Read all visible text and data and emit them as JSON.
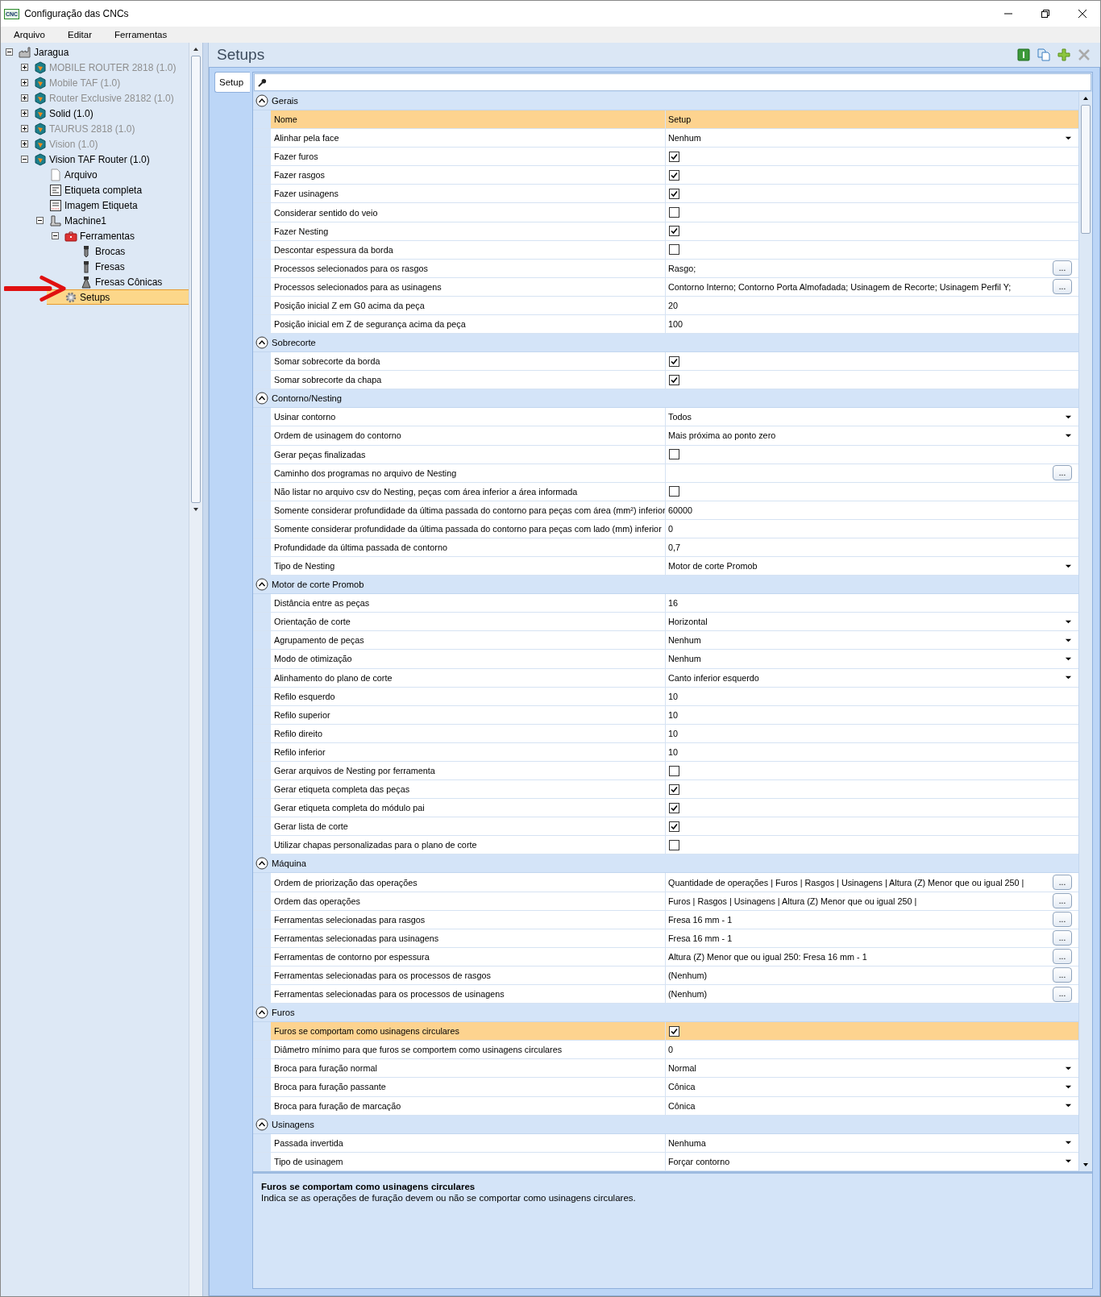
{
  "window": {
    "icon_label": "CNC",
    "title": "Configuração das CNCs"
  },
  "menu": [
    "Arquivo",
    "Editar",
    "Ferramentas"
  ],
  "tree": [
    {
      "label": "Jaragua",
      "kind": "factory",
      "expanded": true,
      "disabled": false,
      "selected": false,
      "children": [
        {
          "label": "MOBILE ROUTER 2818 (1.0)",
          "kind": "machine",
          "expanded": false,
          "disabled": true,
          "selected": false
        },
        {
          "label": "Mobile TAF (1.0)",
          "kind": "machine",
          "expanded": false,
          "disabled": true,
          "selected": false
        },
        {
          "label": "Router Exclusive 28182 (1.0)",
          "kind": "machine",
          "expanded": false,
          "disabled": true,
          "selected": false
        },
        {
          "label": "Solid (1.0)",
          "kind": "machine",
          "expanded": false,
          "disabled": false,
          "selected": false
        },
        {
          "label": "TAURUS 2818 (1.0)",
          "kind": "machine",
          "expanded": false,
          "disabled": true,
          "selected": false
        },
        {
          "label": "Vision (1.0)",
          "kind": "machine",
          "expanded": false,
          "disabled": true,
          "selected": false
        },
        {
          "label": "Vision TAF Router (1.0)",
          "kind": "machine",
          "expanded": true,
          "disabled": false,
          "selected": false,
          "children": [
            {
              "label": "Arquivo",
              "kind": "file",
              "disabled": false,
              "selected": false
            },
            {
              "label": "Etiqueta completa",
              "kind": "label",
              "disabled": false,
              "selected": false
            },
            {
              "label": "Imagem Etiqueta",
              "kind": "image-label",
              "disabled": false,
              "selected": false
            },
            {
              "label": "Machine1",
              "kind": "machine-tool",
              "expanded": true,
              "disabled": false,
              "selected": false,
              "children": [
                {
                  "label": "Ferramentas",
                  "kind": "toolbox",
                  "expanded": true,
                  "disabled": false,
                  "selected": false,
                  "children": [
                    {
                      "label": "Brocas",
                      "kind": "drill",
                      "disabled": false,
                      "selected": false
                    },
                    {
                      "label": "Fresas",
                      "kind": "mill",
                      "disabled": false,
                      "selected": false
                    },
                    {
                      "label": "Fresas Cônicas",
                      "kind": "cone-mill",
                      "disabled": false,
                      "selected": false
                    }
                  ]
                },
                {
                  "label": "Setups",
                  "kind": "gear",
                  "disabled": false,
                  "selected": true
                }
              ]
            }
          ]
        }
      ]
    }
  ],
  "panel": {
    "title": "Setups"
  },
  "tabs": [
    {
      "label": "Setup",
      "selected": true
    }
  ],
  "grid": {
    "columns": [
      "Nome",
      "Setup"
    ],
    "categories": [
      {
        "name": "Gerais",
        "expanded": true,
        "rows": [
          {
            "name": "Alinhar pela face",
            "kind": "dropdown",
            "value": "Nenhum",
            "selected": false
          },
          {
            "name": "Fazer furos",
            "kind": "checkbox",
            "checked": true,
            "selected": false
          },
          {
            "name": "Fazer rasgos",
            "kind": "checkbox",
            "checked": true,
            "selected": false
          },
          {
            "name": "Fazer usinagens",
            "kind": "checkbox",
            "checked": true,
            "selected": false
          },
          {
            "name": "Considerar sentido do veio",
            "kind": "checkbox",
            "checked": false,
            "selected": false
          },
          {
            "name": "Fazer Nesting",
            "kind": "checkbox",
            "checked": true,
            "selected": false
          },
          {
            "name": "Descontar espessura da borda",
            "kind": "checkbox",
            "checked": false,
            "selected": false
          },
          {
            "name": "Processos selecionados para os rasgos",
            "kind": "list",
            "value": "Rasgo;",
            "button": "...",
            "selected": false
          },
          {
            "name": "Processos selecionados para as usinagens",
            "kind": "list",
            "value": "Contorno Interno; Contorno Porta Almofadada; Usinagem de Recorte; Usinagem Perfil Y;",
            "button": "...",
            "selected": false
          },
          {
            "name": "Posição inicial Z em G0 acima da peça",
            "kind": "text",
            "value": "20",
            "selected": false
          },
          {
            "name": "Posição inicial em Z de segurança acima da peça",
            "kind": "text",
            "value": "100",
            "selected": false
          }
        ]
      },
      {
        "name": "Sobrecorte",
        "expanded": true,
        "rows": [
          {
            "name": "Somar sobrecorte da borda",
            "kind": "checkbox",
            "checked": true,
            "selected": false
          },
          {
            "name": "Somar sobrecorte da chapa",
            "kind": "checkbox",
            "checked": true,
            "selected": false
          }
        ]
      },
      {
        "name": "Contorno/Nesting",
        "expanded": true,
        "rows": [
          {
            "name": "Usinar contorno",
            "kind": "dropdown",
            "value": "Todos",
            "selected": false
          },
          {
            "name": "Ordem de usinagem do contorno",
            "kind": "dropdown",
            "value": "Mais próxima ao ponto zero",
            "selected": false
          },
          {
            "name": "Gerar peças finalizadas",
            "kind": "checkbox",
            "checked": false,
            "selected": false
          },
          {
            "name": "Caminho dos programas no arquivo de Nesting",
            "kind": "list",
            "button": "...",
            "selected": false
          },
          {
            "name": "Não listar no arquivo csv do Nesting, peças com área inferior a área informada",
            "kind": "checkbox",
            "checked": false,
            "selected": false
          },
          {
            "name": "Somente considerar profundidade da última passada do contorno para peças com área (mm²) inferior",
            "kind": "text",
            "value": "60000",
            "selected": false
          },
          {
            "name": "Somente considerar profundidade da última passada do contorno para peças com lado (mm) inferior",
            "kind": "text",
            "value": "0",
            "selected": false
          },
          {
            "name": "Profundidade da última passada de contorno",
            "kind": "text",
            "value": "0,7",
            "selected": false
          },
          {
            "name": "Tipo de Nesting",
            "kind": "dropdown",
            "value": "Motor de corte Promob",
            "selected": false
          }
        ]
      },
      {
        "name": "Motor de corte Promob",
        "expanded": true,
        "rows": [
          {
            "name": "Distância entre as peças",
            "kind": "text",
            "value": "16",
            "selected": false
          },
          {
            "name": "Orientação de corte",
            "kind": "dropdown",
            "value": "Horizontal",
            "selected": false
          },
          {
            "name": "Agrupamento de peças",
            "kind": "dropdown",
            "value": "Nenhum",
            "selected": false
          },
          {
            "name": "Modo de otimização",
            "kind": "dropdown",
            "value": "Nenhum",
            "selected": false
          },
          {
            "name": "Alinhamento do plano de corte",
            "kind": "dropdown",
            "value": "Canto inferior esquerdo",
            "selected": false
          },
          {
            "name": "Refilo esquerdo",
            "kind": "text",
            "value": "10",
            "selected": false
          },
          {
            "name": "Refilo superior",
            "kind": "text",
            "value": "10",
            "selected": false
          },
          {
            "name": "Refilo direito",
            "kind": "text",
            "value": "10",
            "selected": false
          },
          {
            "name": "Refilo inferior",
            "kind": "text",
            "value": "10",
            "selected": false
          },
          {
            "name": "Gerar arquivos de Nesting por ferramenta",
            "kind": "checkbox",
            "checked": false,
            "selected": false
          },
          {
            "name": "Gerar etiqueta completa das peças",
            "kind": "checkbox",
            "checked": true,
            "selected": false
          },
          {
            "name": "Gerar etiqueta completa do módulo pai",
            "kind": "checkbox",
            "checked": true,
            "selected": false
          },
          {
            "name": "Gerar lista de corte",
            "kind": "checkbox",
            "checked": true,
            "selected": false
          },
          {
            "name": "Utilizar chapas personalizadas para o plano de corte",
            "kind": "checkbox",
            "checked": false,
            "selected": false
          }
        ]
      },
      {
        "name": "Máquina",
        "expanded": true,
        "rows": [
          {
            "name": "Ordem de priorização das operações",
            "kind": "list",
            "value": "Quantidade de operações | Furos | Rasgos | Usinagens | Altura (Z) Menor que ou igual 250 |",
            "button": "...",
            "selected": false
          },
          {
            "name": "Ordem das operações",
            "kind": "list",
            "value": "Furos | Rasgos | Usinagens | Altura (Z) Menor que ou igual 250 |",
            "button": "...",
            "selected": false
          },
          {
            "name": "Ferramentas selecionadas para rasgos",
            "kind": "list",
            "value": "Fresa 16 mm - 1",
            "button": "...",
            "selected": false
          },
          {
            "name": "Ferramentas selecionadas para usinagens",
            "kind": "list",
            "value": "Fresa 16 mm - 1",
            "button": "...",
            "selected": false
          },
          {
            "name": "Ferramentas de contorno por espessura",
            "kind": "list",
            "value": "Altura (Z) Menor que ou igual 250: Fresa 16 mm - 1",
            "button": "...",
            "selected": false
          },
          {
            "name": "Ferramentas selecionadas para os processos de rasgos",
            "kind": "list",
            "value": "(Nenhum)",
            "button": "...",
            "selected": false
          },
          {
            "name": "Ferramentas selecionadas para os processos de usinagens",
            "kind": "list",
            "value": "(Nenhum)",
            "button": "...",
            "selected": false
          }
        ]
      },
      {
        "name": "Furos",
        "expanded": true,
        "rows": [
          {
            "name": "Furos se comportam como usinagens circulares",
            "kind": "checkbox",
            "checked": true,
            "selected": true
          },
          {
            "name": "Diâmetro mínimo para que furos se comportem como usinagens circulares",
            "kind": "text",
            "value": "0",
            "selected": false
          },
          {
            "name": "Broca para furação normal",
            "kind": "dropdown",
            "value": "Normal",
            "selected": false
          },
          {
            "name": "Broca para furação passante",
            "kind": "dropdown",
            "value": "Cônica",
            "selected": false
          },
          {
            "name": "Broca para furação de marcação",
            "kind": "dropdown",
            "value": "Cônica",
            "selected": false
          }
        ]
      },
      {
        "name": "Usinagens",
        "expanded": true,
        "rows": [
          {
            "name": "Passada invertida",
            "kind": "dropdown",
            "value": "Nenhuma",
            "selected": false
          },
          {
            "name": "Tipo de usinagem",
            "kind": "dropdown",
            "value": "Forçar contorno",
            "selected": false
          }
        ]
      }
    ]
  },
  "description": {
    "title": "Furos se comportam como usinagens circulares",
    "text": "Indica se as operações de furação devem ou não se comportar como usinagens circulares."
  }
}
